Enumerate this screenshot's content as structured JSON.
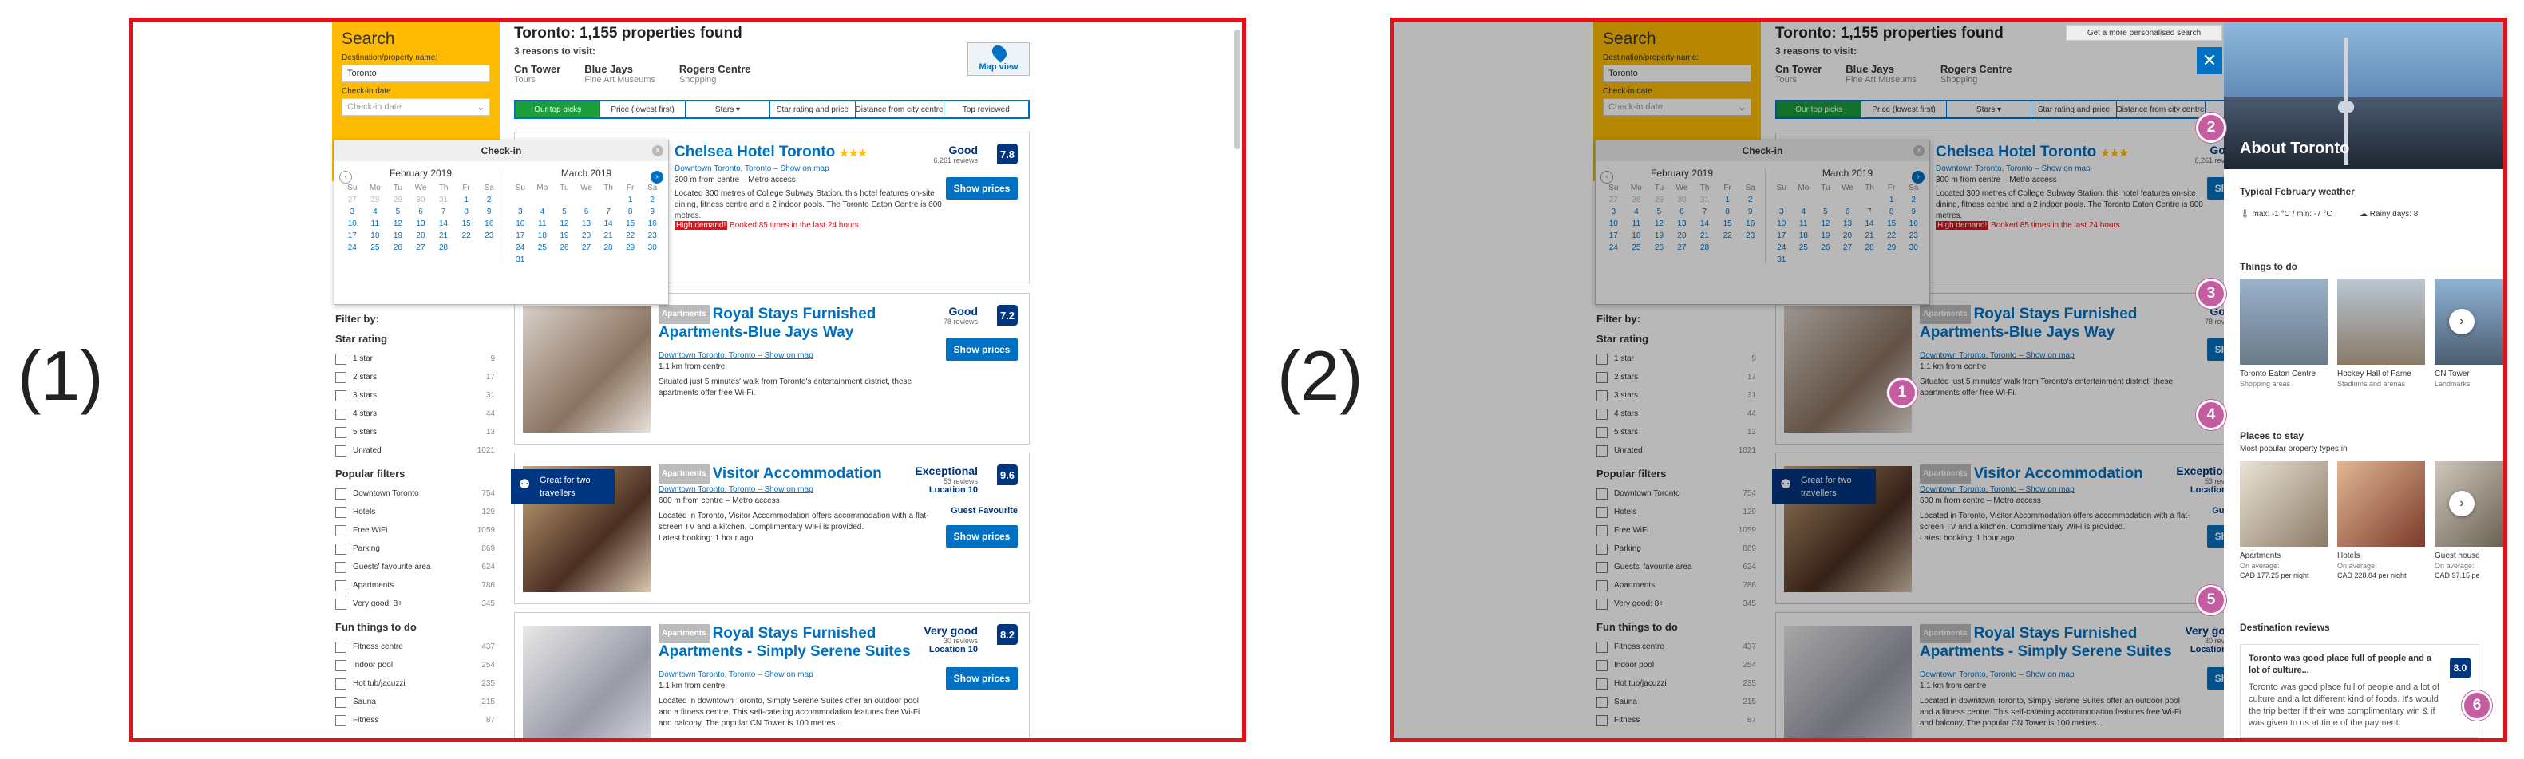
{
  "panel_labels": [
    "(1)",
    "(2)"
  ],
  "search": {
    "title": "Search",
    "dest_label": "Destination/property name:",
    "dest_value": "Toronto",
    "checkin_label": "Check-in date",
    "checkin_placeholder": "Check-in date"
  },
  "header": {
    "title": "Toronto: 1,155 properties found",
    "reasons_title": "3 reasons to visit:",
    "reasons": [
      {
        "name": "Cn Tower",
        "sub": "Tours"
      },
      {
        "name": "Blue Jays",
        "sub": "Fine Art Museums"
      },
      {
        "name": "Rogers Centre",
        "sub": "Shopping"
      }
    ]
  },
  "map_label": "Map view",
  "tabs": [
    "Our top picks",
    "Price (lowest first)",
    "Stars ▾",
    "Star rating and price",
    "Distance from city centre",
    "Top reviewed"
  ],
  "calendar": {
    "title": "Check-in",
    "close": "x",
    "months": [
      {
        "name": "February 2019",
        "days": [
          "Su",
          "Mo",
          "Tu",
          "We",
          "Th",
          "Fr",
          "Sa"
        ],
        "rows": [
          [
            "27",
            "28",
            "29",
            "30",
            "31",
            "1",
            "2"
          ],
          [
            "3",
            "4",
            "5",
            "6",
            "7",
            "8",
            "9"
          ],
          [
            "10",
            "11",
            "12",
            "13",
            "14",
            "15",
            "16"
          ],
          [
            "17",
            "18",
            "19",
            "20",
            "21",
            "22",
            "23"
          ],
          [
            "24",
            "25",
            "26",
            "27",
            "28",
            "",
            ""
          ]
        ]
      },
      {
        "name": "March 2019",
        "days": [
          "Su",
          "Mo",
          "Tu",
          "We",
          "Th",
          "Fr",
          "Sa"
        ],
        "rows": [
          [
            "",
            "",
            "",
            "",
            "",
            "1",
            "2"
          ],
          [
            "3",
            "4",
            "5",
            "6",
            "7",
            "8",
            "9"
          ],
          [
            "10",
            "11",
            "12",
            "13",
            "14",
            "15",
            "16"
          ],
          [
            "17",
            "18",
            "19",
            "20",
            "21",
            "22",
            "23"
          ],
          [
            "24",
            "25",
            "26",
            "27",
            "28",
            "29",
            "30"
          ],
          [
            "31",
            "",
            "",
            "",
            "",
            "",
            ""
          ]
        ]
      }
    ]
  },
  "filters": {
    "title": "Filter by:",
    "groups": [
      {
        "heading": "Star rating",
        "items": [
          [
            "1 star",
            "9"
          ],
          [
            "2 stars",
            "17"
          ],
          [
            "3 stars",
            "31"
          ],
          [
            "4 stars",
            "44"
          ],
          [
            "5 stars",
            "13"
          ],
          [
            "Unrated",
            "1021"
          ]
        ]
      },
      {
        "heading": "Popular filters",
        "items": [
          [
            "Downtown Toronto",
            "754"
          ],
          [
            "Hotels",
            "129"
          ],
          [
            "Free WiFi",
            "1059"
          ],
          [
            "Parking",
            "869"
          ],
          [
            "Guests' favourite area",
            "624"
          ],
          [
            "Apartments",
            "786"
          ],
          [
            "Very good: 8+",
            "345"
          ]
        ]
      },
      {
        "heading": "Fun things to do",
        "items": [
          [
            "Fitness centre",
            "437"
          ],
          [
            "Indoor pool",
            "254"
          ],
          [
            "Hot tub/jacuzzi",
            "235"
          ],
          [
            "Sauna",
            "215"
          ],
          [
            "Fitness",
            "87"
          ]
        ]
      }
    ]
  },
  "cards": [
    {
      "name": "Chelsea Hotel Toronto",
      "stars": "★★★",
      "word": "Good",
      "reviews": "6,261 reviews",
      "score": "7.8",
      "loc": "Downtown Toronto, Toronto – Show on map",
      "dist": "300 m from centre – Metro access",
      "desc": "Located 300 metres of College Subway Station, this hotel features on-site dining, fitness centre and a 2 indoor pools. The Toronto Eaton Centre is 600 metres.",
      "demand": "High demand!",
      "demand_text": "Booked 85 times in the last 24 hours",
      "show": "Show prices"
    },
    {
      "badge": "Apartments",
      "name": "Royal Stays Furnished Apartments-Blue Jays Way",
      "word": "Good",
      "reviews": "78 reviews",
      "score": "7.2",
      "loc": "Downtown Toronto, Toronto – Show on map",
      "dist": "1.1 km from centre",
      "desc": "Situated just 5 minutes' walk from Toronto's entertainment district, these apartments offer free Wi-Fi.",
      "show": "Show prices"
    },
    {
      "badge": "Apartments",
      "name": "Visitor Accommodation",
      "word": "Exceptional",
      "reviews": "53 reviews",
      "score": "9.6",
      "location": "Location 10",
      "guest": "Guest Favourite",
      "loc": "Downtown Toronto, Toronto – Show on map",
      "dist": "600 m from centre – Metro access",
      "desc": "Located in Toronto, Visitor Accommodation offers accommodation with a flat-screen TV and a kitchen. Complimentary WiFi is provided.",
      "latest": "Latest booking: 1 hour ago",
      "greatfor": "Great for two travellers",
      "show": "Show prices"
    },
    {
      "badge": "Apartments",
      "name": "Royal Stays Furnished Apartments - Simply Serene Suites",
      "word": "Very good",
      "reviews": "30 reviews",
      "score": "8.2",
      "location": "Location 10",
      "loc": "Downtown Toronto, Toronto – Show on map",
      "dist": "1.1 km from centre",
      "desc": "Located in downtown Toronto, Simply Serene Suites offer an outdoor pool and a fitness centre. This self-catering accommodation features free Wi-Fi and balcony. The popular CN Tower is 100 metres...",
      "show": "Show prices"
    }
  ],
  "aside": {
    "personal": "Get a more personalised search",
    "close": "✕",
    "title": "About Toronto",
    "weather_h": "Typical February weather",
    "weather_temp": "max: -1 °C / min: -7 °C",
    "weather_rain": "Rainy days: 8",
    "todo_h": "Things to do",
    "todo": [
      {
        "name": "Toronto Eaton Centre",
        "sub": "Shopping areas"
      },
      {
        "name": "Hockey Hall of Fame",
        "sub": "Stadiums and arenas"
      },
      {
        "name": "CN Tower",
        "sub": "Landmarks"
      }
    ],
    "stay_h": "Places to stay",
    "stay_sub": "Most popular property types in",
    "stay": [
      {
        "name": "Apartments",
        "sub": "On average:",
        "price": "CAD 177.25 per night"
      },
      {
        "name": "Hotels",
        "sub": "On average:",
        "price": "CAD 228.84 per night"
      },
      {
        "name": "Guest house",
        "sub": "On average:",
        "price": "CAD 97.15 pe"
      }
    ],
    "reviews_h": "Destination reviews",
    "review": {
      "title": "Toronto was good place full of people and a lot of culture...",
      "body": "Toronto was good place full of people and a lot of culture and a lot different kind of foods. It's would the trip better if their was complimentary win & if was given to us at time of the payment.",
      "score": "8.0"
    }
  },
  "markers": [
    "1",
    "2",
    "3",
    "4",
    "5",
    "6"
  ],
  "colors": {
    "frame": "#e1121b",
    "brand": "#0071c2",
    "yellow": "#febb02",
    "marker": "#c45c9f",
    "navy": "#003580"
  }
}
